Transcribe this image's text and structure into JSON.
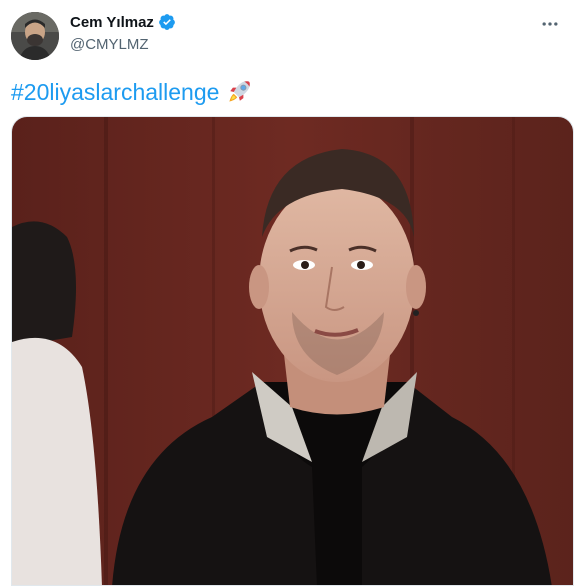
{
  "tweet": {
    "display_name": "Cem Yılmaz",
    "handle": "@CMYLMZ",
    "text": "#20liyaslarchallenge",
    "verified": true,
    "icons": {
      "verified": "verified-badge-icon",
      "more": "more-options-icon",
      "emoji": "rocket-emoji"
    }
  },
  "colors": {
    "link": "#1d9bf0",
    "name": "#0f1419",
    "handle": "#536471",
    "verified": "#1d9bf0"
  }
}
